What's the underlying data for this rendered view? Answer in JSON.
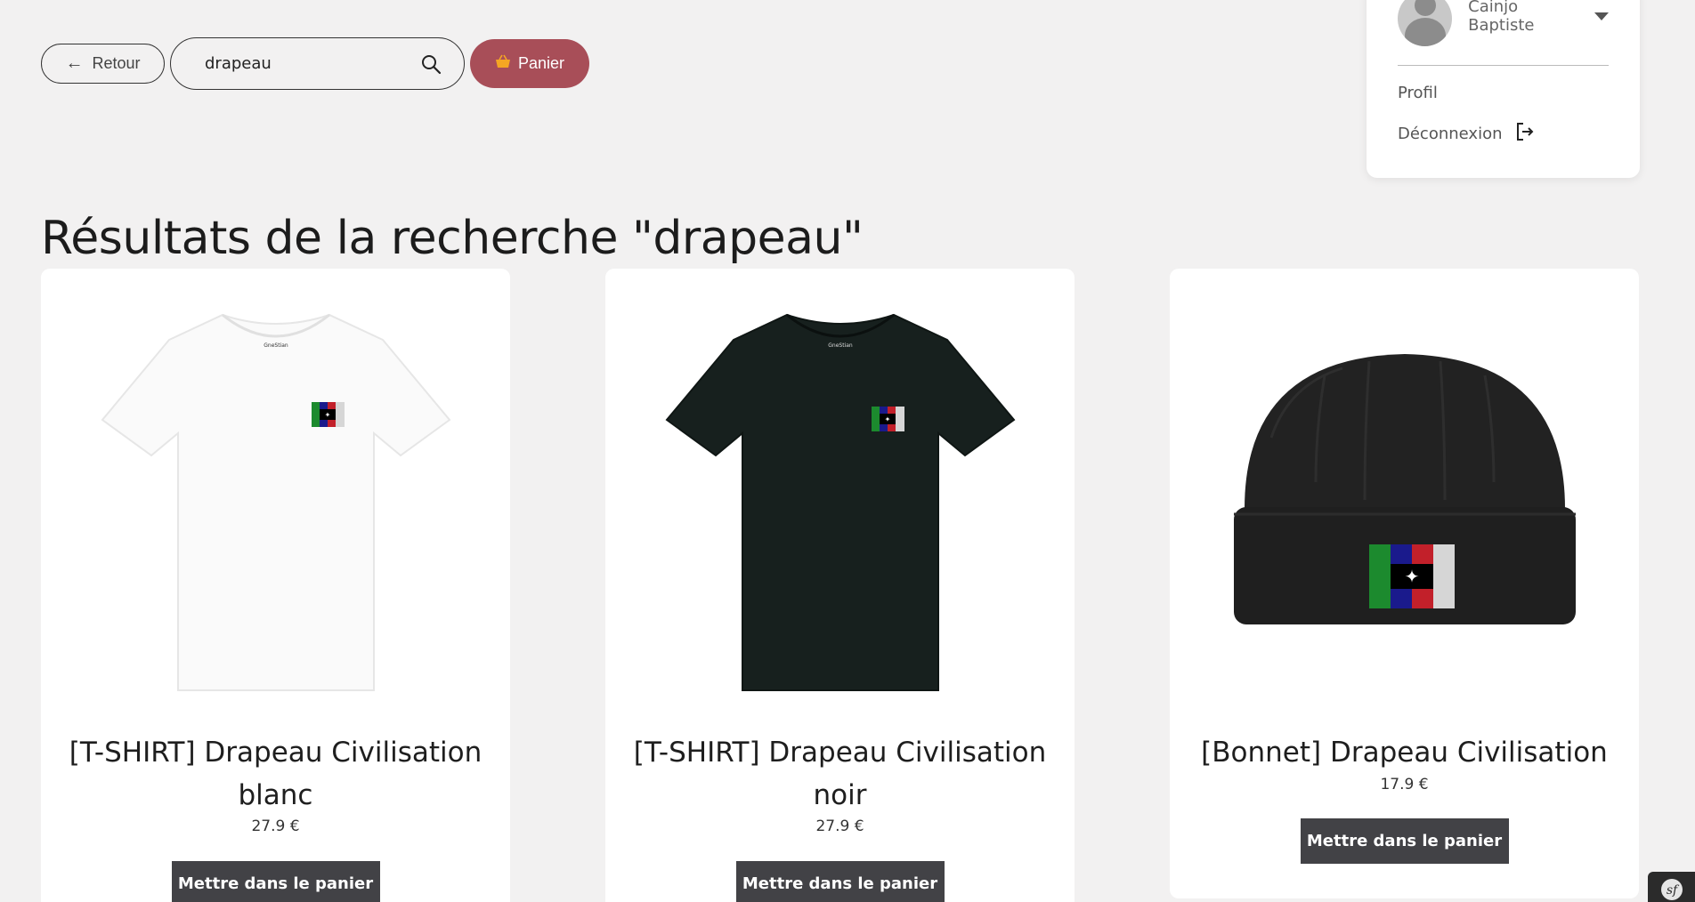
{
  "nav": {
    "back_label": "Retour",
    "search_value": "drapeau",
    "cart_label": "Panier"
  },
  "user": {
    "name": "Cainjo Baptiste",
    "profile_label": "Profil",
    "logout_label": "Déconnexion"
  },
  "page": {
    "title": "Résultats de la recherche \"drapeau\""
  },
  "products": [
    {
      "name": "[T-SHIRT] Drapeau Civilisation blanc",
      "price": "27.9 €",
      "button": "Mettre dans le panier",
      "color": "#ffffff"
    },
    {
      "name": "[T-SHIRT] Drapeau Civilisation noir",
      "price": "27.9 €",
      "button": "Mettre dans le panier",
      "color": "#17201e"
    },
    {
      "name": "[Bonnet] Drapeau Civilisation",
      "price": "17.9 €",
      "button": "Mettre dans le panier",
      "color": "#222222"
    }
  ],
  "colors": {
    "background": "#f2f1f1",
    "cart_button": "#a84e58",
    "add_button": "#424246",
    "flag": [
      "#1c8a2e",
      "#1a1a8c",
      "#000000",
      "#c2202a",
      "#d6d6d6"
    ]
  }
}
